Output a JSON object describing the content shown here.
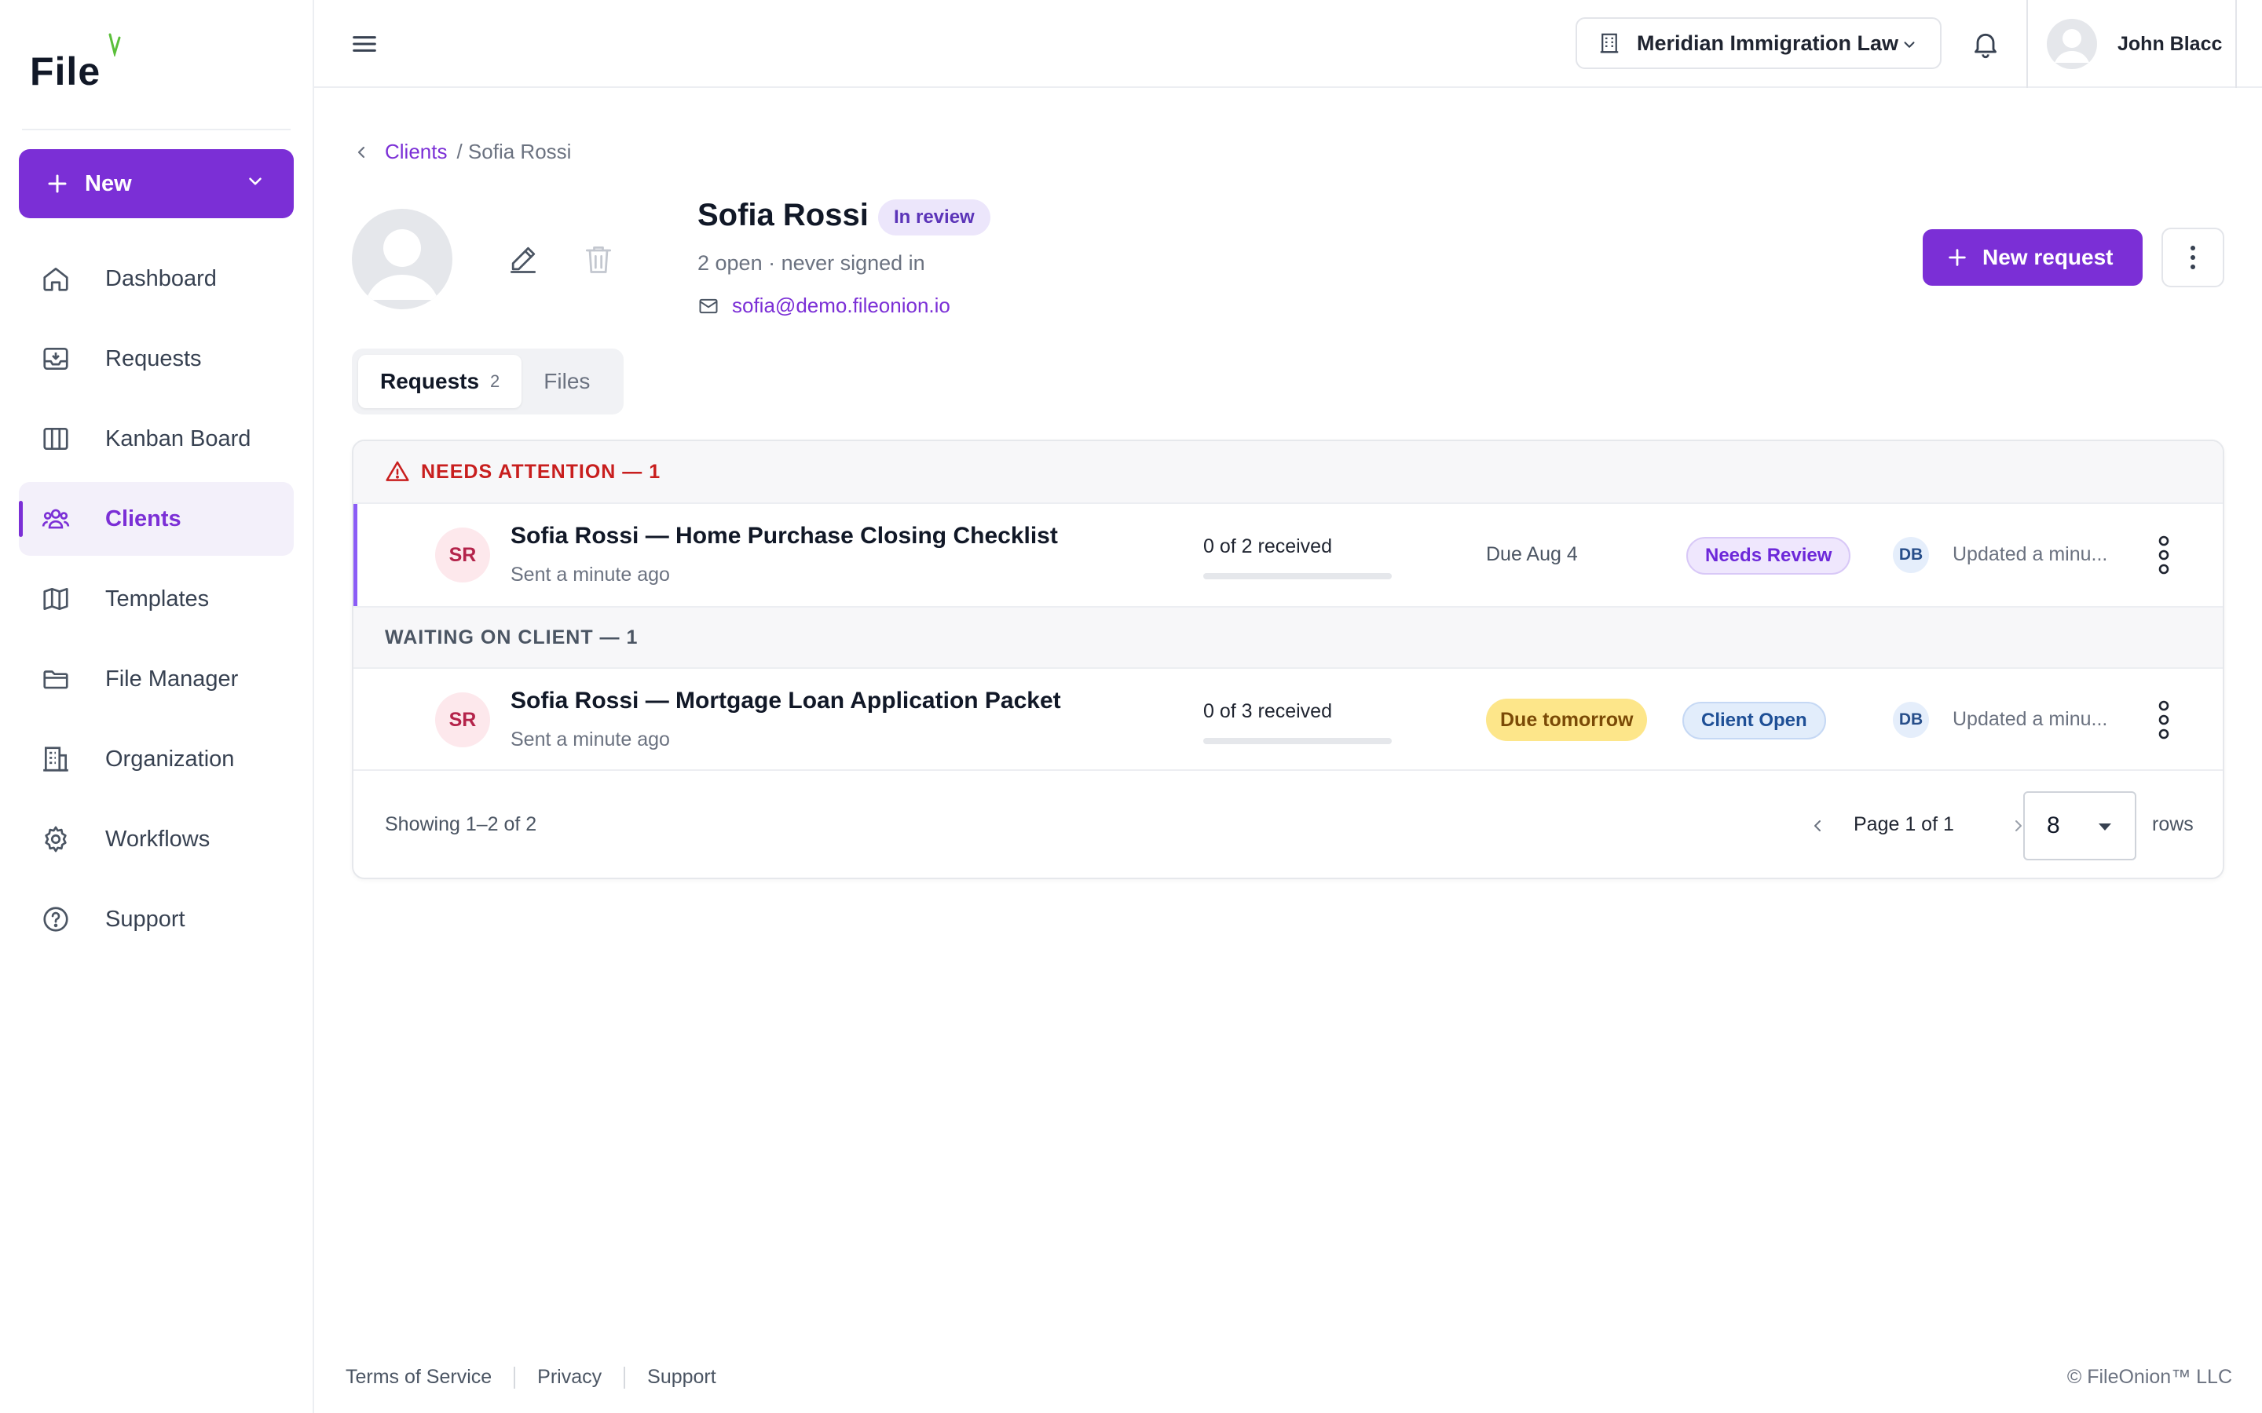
{
  "app": {
    "logo_text": "File"
  },
  "sidebar": {
    "new_label": "New",
    "items": [
      {
        "label": "Dashboard",
        "icon": "home-icon"
      },
      {
        "label": "Requests",
        "icon": "inbox-icon"
      },
      {
        "label": "Kanban Board",
        "icon": "columns-icon"
      },
      {
        "label": "Clients",
        "icon": "users-icon",
        "active": true
      },
      {
        "label": "Templates",
        "icon": "map-icon"
      },
      {
        "label": "File Manager",
        "icon": "folder-icon"
      },
      {
        "label": "Organization",
        "icon": "building-icon"
      },
      {
        "label": "Workflows",
        "icon": "gear-icon"
      },
      {
        "label": "Support",
        "icon": "help-circle-icon"
      }
    ]
  },
  "topbar": {
    "org_name": "Meridian Immigration Law",
    "user_name": "John Blacc"
  },
  "breadcrumb": {
    "parent": "Clients",
    "current": "/ Sofia Rossi"
  },
  "client": {
    "name": "Sofia Rossi",
    "status": "In review",
    "meta": "2 open · never signed in",
    "email": "sofia@demo.fileonion.io"
  },
  "actions": {
    "new_request": "New request"
  },
  "tabs": [
    {
      "label": "Requests",
      "count": "2",
      "active": true
    },
    {
      "label": "Files"
    }
  ],
  "groups": {
    "attention": {
      "title": "NEEDS ATTENTION — 1"
    },
    "waiting": {
      "title": "WAITING ON CLIENT — 1"
    }
  },
  "rows": [
    {
      "initials": "SR",
      "title": "Sofia Rossi — Home Purchase Closing Checklist",
      "sent": "Sent a minute ago",
      "progress_text": "0 of 2 received",
      "progress": 0,
      "due": "Due Aug 4",
      "status": "Needs Review",
      "assignee": "DB",
      "updated": "Updated a minu..."
    },
    {
      "initials": "SR",
      "title": "Sofia Rossi — Mortgage Loan Application Packet",
      "sent": "Sent a minute ago",
      "progress_text": "0 of 3 received",
      "progress": 0,
      "due": "Due tomorrow",
      "status": "Client Open",
      "assignee": "DB",
      "updated": "Updated a minu..."
    }
  ],
  "pagination": {
    "showing": "Showing 1–2 of 2",
    "page": "Page 1 of 1",
    "rows_value": "8",
    "rows_label": "rows"
  },
  "footer": {
    "links": [
      "Terms of Service",
      "Privacy",
      "Support"
    ],
    "copyright": "© FileOnion™ LLC"
  },
  "colors": {
    "accent": "#7b2fd6",
    "danger": "#c81e1e",
    "due_soon": "#fde68a"
  }
}
